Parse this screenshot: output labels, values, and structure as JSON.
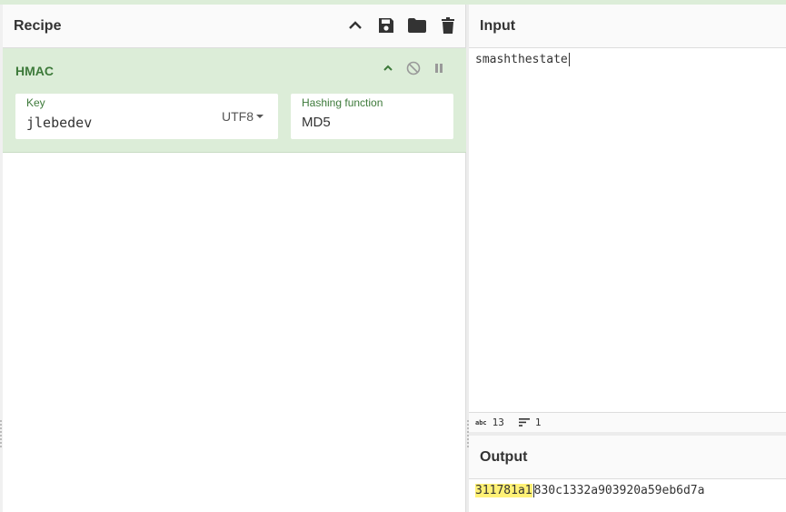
{
  "recipe": {
    "title": "Recipe",
    "icons": [
      "chevron-up-icon",
      "save-icon",
      "folder-icon",
      "trash-icon"
    ]
  },
  "operation": {
    "name": "HMAC",
    "controls": [
      "chevron-up-icon",
      "disable-icon",
      "pause-icon"
    ],
    "key": {
      "label": "Key",
      "value": "jlebedev",
      "encoding": "UTF8"
    },
    "hashing": {
      "label": "Hashing function",
      "value": "MD5"
    }
  },
  "input": {
    "title": "Input",
    "text": "smashthestate",
    "stats": {
      "length_icon": "abc",
      "length": "13",
      "lines": "1"
    }
  },
  "output": {
    "title": "Output",
    "highlighted": "311781a1",
    "rest": "830c1332a903920a59eb6d7a"
  },
  "colors": {
    "op_bg": "#dcedd8",
    "op_text": "#3d7a3a",
    "highlight": "#fff176"
  }
}
